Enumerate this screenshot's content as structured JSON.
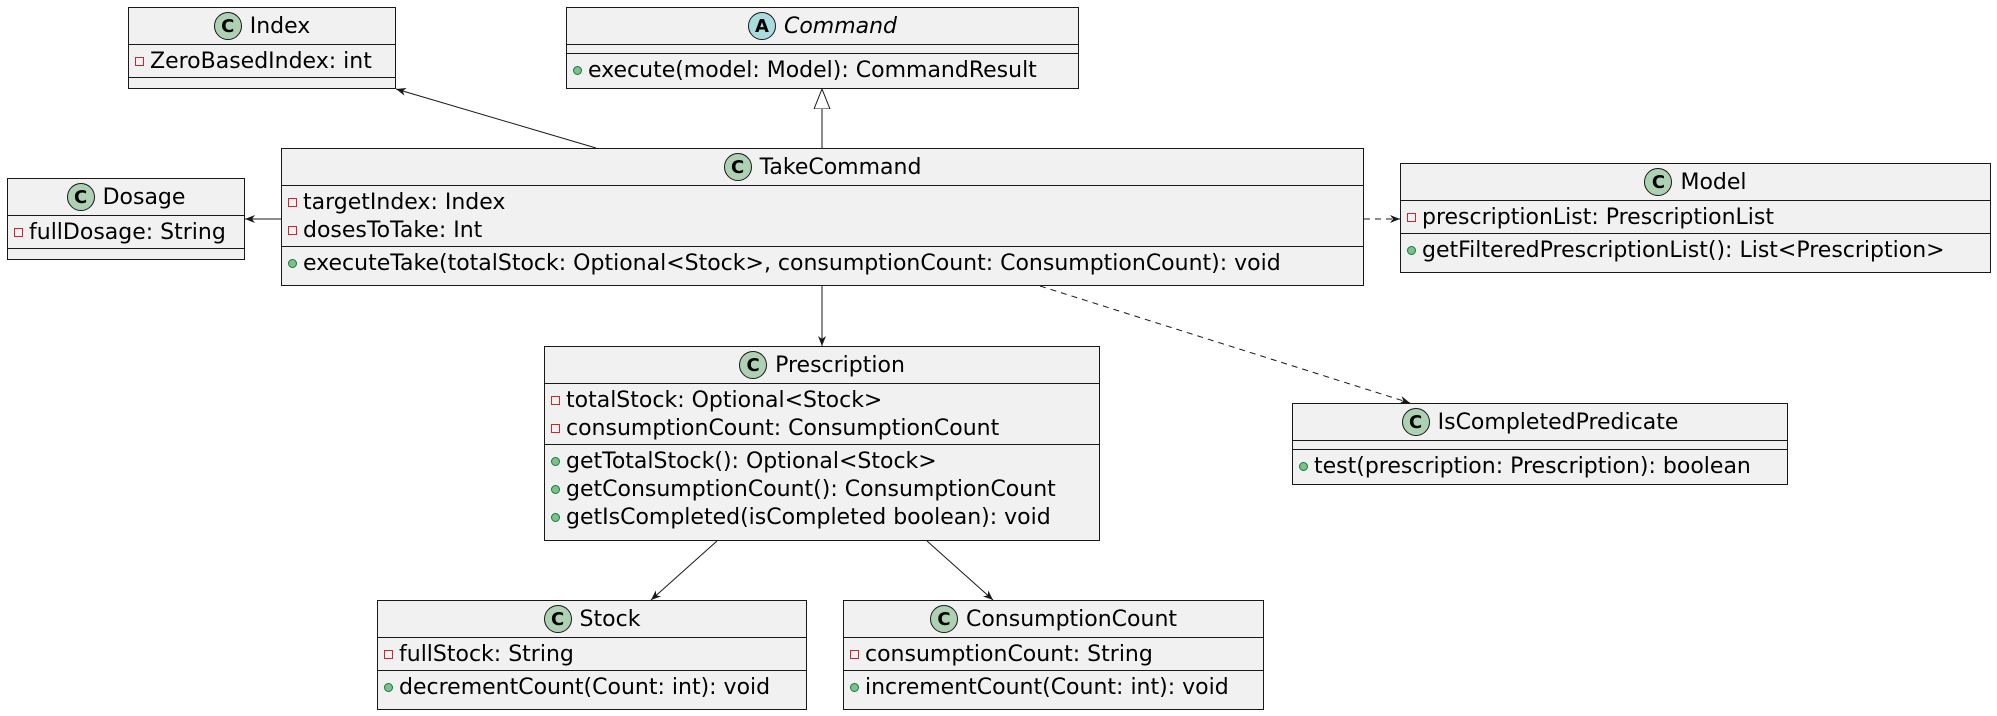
{
  "classes": {
    "index": {
      "stereotype": "C",
      "name": "Index",
      "fields": [
        "ZeroBasedIndex: int"
      ],
      "methods": []
    },
    "command": {
      "stereotype": "A",
      "name": "Command",
      "fields": [],
      "methods": [
        "execute(model: Model): CommandResult"
      ]
    },
    "dosage": {
      "stereotype": "C",
      "name": "Dosage",
      "fields": [
        "fullDosage: String"
      ],
      "methods": []
    },
    "take_command": {
      "stereotype": "C",
      "name": "TakeCommand",
      "fields": [
        "targetIndex: Index",
        "dosesToTake: Int"
      ],
      "methods": [
        "executeTake(totalStock: Optional<Stock>, consumptionCount: ConsumptionCount): void"
      ]
    },
    "model": {
      "stereotype": "C",
      "name": "Model",
      "fields": [
        "prescriptionList: PrescriptionList"
      ],
      "methods": [
        "getFilteredPrescriptionList(): List<Prescription>"
      ]
    },
    "prescription": {
      "stereotype": "C",
      "name": "Prescription",
      "fields": [
        "totalStock: Optional<Stock>",
        "consumptionCount: ConsumptionCount"
      ],
      "methods": [
        "getTotalStock(): Optional<Stock>",
        "getConsumptionCount(): ConsumptionCount",
        "getIsCompleted(isCompleted boolean): void"
      ]
    },
    "is_completed_predicate": {
      "stereotype": "C",
      "name": "IsCompletedPredicate",
      "fields": [],
      "methods": [
        "test(prescription: Prescription): boolean"
      ]
    },
    "stock": {
      "stereotype": "C",
      "name": "Stock",
      "fields": [
        "fullStock: String"
      ],
      "methods": [
        "decrementCount(Count: int): void"
      ]
    },
    "consumption_count": {
      "stereotype": "C",
      "name": "ConsumptionCount",
      "fields": [
        "consumptionCount: String"
      ],
      "methods": [
        "incrementCount(Count: int): void"
      ]
    }
  },
  "colors": {
    "class_fill": "#f1f1f1",
    "border": "#181818",
    "class_badge": "#add1b2",
    "abstract_badge": "#a9dcdf",
    "private_marker": "#c82930",
    "public_marker": "#84be84"
  }
}
